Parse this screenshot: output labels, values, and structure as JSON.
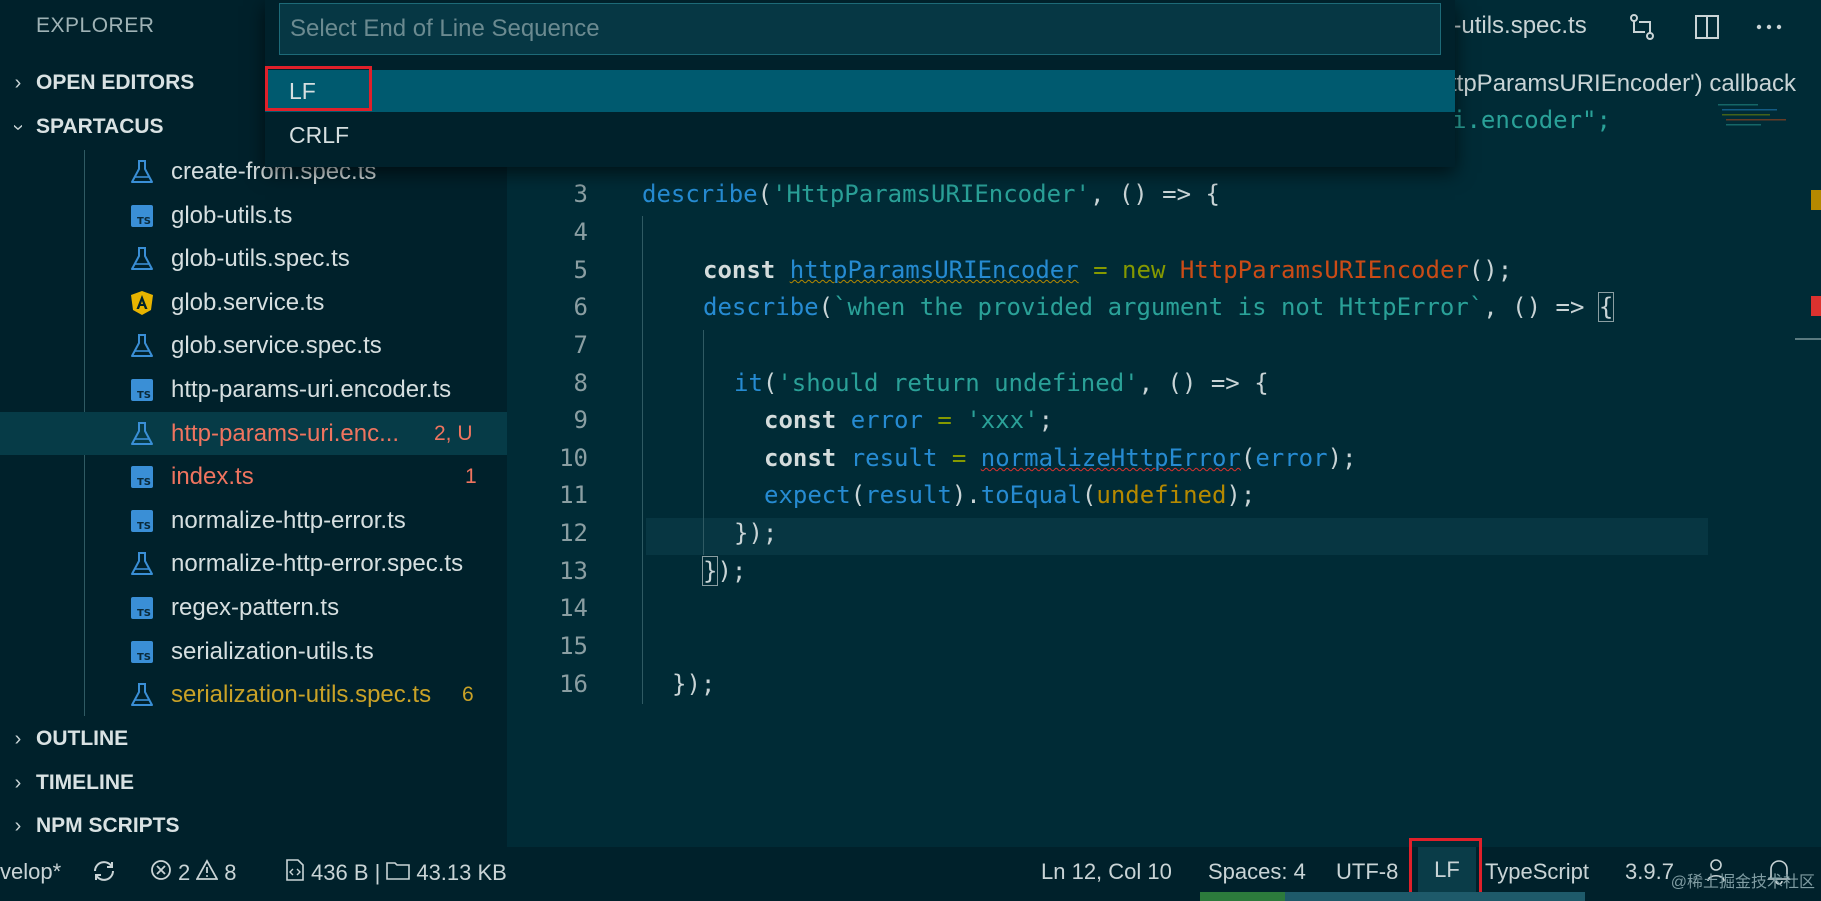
{
  "explorer": {
    "title": "EXPLORER",
    "sections": {
      "open_editors": "OPEN EDITORS",
      "project": "SPARTACUS",
      "outline": "OUTLINE",
      "timeline": "TIMELINE",
      "npm_scripts": "NPM SCRIPTS"
    },
    "files": [
      {
        "name": "create-from.spec.ts",
        "icon": "flask-icon",
        "badge": "",
        "color": "#d6dfe0"
      },
      {
        "name": "glob-utils.ts",
        "icon": "typescript-icon",
        "badge": "",
        "color": "#d6dfe0"
      },
      {
        "name": "glob-utils.spec.ts",
        "icon": "flask-icon",
        "badge": "",
        "color": "#d6dfe0"
      },
      {
        "name": "glob.service.ts",
        "icon": "angular-icon",
        "badge": "",
        "color": "#d6dfe0"
      },
      {
        "name": "glob.service.spec.ts",
        "icon": "flask-icon",
        "badge": "",
        "color": "#d6dfe0"
      },
      {
        "name": "http-params-uri.encoder.ts",
        "icon": "typescript-icon",
        "badge": "",
        "color": "#d6dfe0"
      },
      {
        "name": "http-params-uri.enc...",
        "icon": "flask-icon",
        "badge": "2, U",
        "color": "#f0745f"
      },
      {
        "name": "index.ts",
        "icon": "typescript-icon",
        "badge": "1",
        "color": "#f0745f"
      },
      {
        "name": "normalize-http-error.ts",
        "icon": "typescript-icon",
        "badge": "",
        "color": "#d6dfe0"
      },
      {
        "name": "normalize-http-error.spec.ts",
        "icon": "flask-icon",
        "badge": "",
        "color": "#d6dfe0"
      },
      {
        "name": "regex-pattern.ts",
        "icon": "typescript-icon",
        "badge": "",
        "color": "#d6dfe0"
      },
      {
        "name": "serialization-utils.ts",
        "icon": "typescript-icon",
        "badge": "",
        "color": "#d6dfe0"
      },
      {
        "name": "serialization-utils.spec.ts",
        "icon": "flask-icon",
        "badge": "6",
        "color": "#c9a227"
      }
    ]
  },
  "editor": {
    "tab_name": "n-utils.spec.ts",
    "breadcrumb": "ttpParamsURIEncoder') callback",
    "line2_tail": "i.encoder\";",
    "line_numbers": [
      "3",
      "4",
      "5",
      "6",
      "7",
      "8",
      "9",
      "10",
      "11",
      "12",
      "13",
      "14",
      "15",
      "16"
    ],
    "code": {
      "l3_describe": "describe",
      "l3_open": "(",
      "l3_str": "'HttpParamsURIEncoder'",
      "l3_rest": ", () => {",
      "l5_const": "const",
      "l5_var": "httpParamsURIEncoder",
      "l5_eq": " = ",
      "l5_new": "new",
      "l5_cls": "HttpParamsURIEncoder",
      "l5_end": "();",
      "l6_describe": "describe",
      "l6_open": "(",
      "l6_str": "`when the provided argument is not HttpError`",
      "l6_rest": ", () => ",
      "l6_brace": "{",
      "l8_it": "it",
      "l8_open": "(",
      "l8_str": "'should return undefined'",
      "l8_rest": ", () => {",
      "l9_const": "const",
      "l9_var": "error",
      "l9_eq": " = ",
      "l9_str": "'xxx'",
      "l9_end": ";",
      "l10_const": "const",
      "l10_var": "result",
      "l10_eq": " = ",
      "l10_fn": "normalizeHttpError",
      "l10_open": "(",
      "l10_arg": "error",
      "l10_end": ");",
      "l11_expect": "expect",
      "l11_open": "(",
      "l11_arg": "result",
      "l11_mid": ").",
      "l11_fn": "toEqual",
      "l11_open2": "(",
      "l11_undef": "undefined",
      "l11_end": ");",
      "l12": "});",
      "l13_brace": "}",
      "l13_end": ");",
      "l16": "});"
    }
  },
  "quick_pick": {
    "placeholder": "Select End of Line Sequence",
    "options": [
      "LF",
      "CRLF"
    ],
    "selected": "LF"
  },
  "status_bar": {
    "branch": "velop*",
    "errors": "2",
    "warnings": "8",
    "file_size": "436 B |",
    "folder_size": "43.13 KB",
    "cursor": "Ln 12, Col 10",
    "spaces": "Spaces: 4",
    "encoding": "UTF-8",
    "eol": "LF",
    "language": "TypeScript",
    "version": "3.9.7",
    "watermark": "@稀土掘金技术社区"
  },
  "colors": {
    "highlight": "#e0202a",
    "background": "#002b36",
    "sidebar": "#00212b",
    "accent": "#005a6f"
  }
}
